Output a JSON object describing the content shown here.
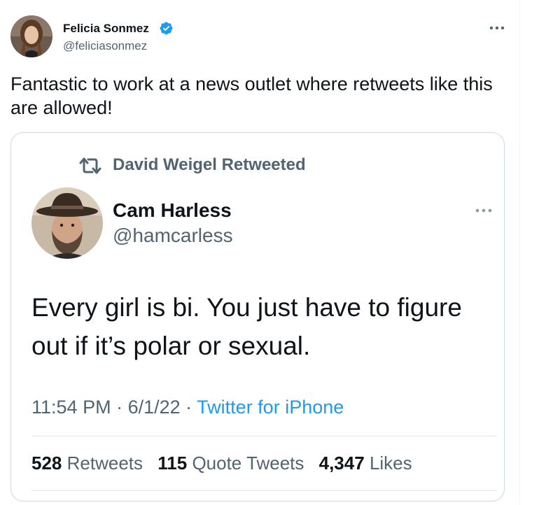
{
  "tweet": {
    "author": {
      "name": "Felicia Sonmez",
      "handle": "@feliciasonmez",
      "verified": true
    },
    "more_icon": "more-horizontal-icon",
    "text": "Fantastic to work at a news outlet where retweets like this are allowed!"
  },
  "quoted": {
    "retweet_icon": "retweet-icon",
    "retweeted_by": "David Weigel Retweeted",
    "author": {
      "name": "Cam Harless",
      "handle": "@hamcarless"
    },
    "more_icon": "more-horizontal-icon",
    "text": "Every girl is bi. You just have to figure out if it’s polar or sexual.",
    "time": "11:54 PM",
    "date": "6/1/22",
    "separator": " · ",
    "source": "Twitter for iPhone",
    "stats": [
      {
        "value": "528",
        "label": "Retweets"
      },
      {
        "value": "115",
        "label": "Quote Tweets"
      },
      {
        "value": "4,347",
        "label": "Likes"
      }
    ]
  },
  "colors": {
    "text": "#0f1419",
    "secondary": "#536471",
    "link": "#1d9bf0",
    "verified": "#1d9bf0",
    "border": "#cfd9de"
  }
}
